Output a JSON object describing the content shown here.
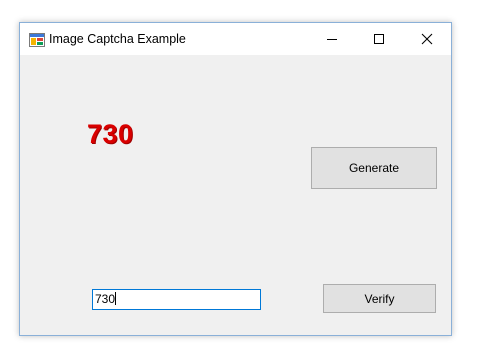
{
  "window": {
    "title": "Image Captcha Example",
    "icon": "form-app-icon",
    "controls": [
      "minimize-icon",
      "maximize-icon",
      "close-icon"
    ]
  },
  "form": {
    "captcha_text": "730",
    "captcha_color": "#d90000",
    "generate_label": "Generate",
    "verify_label": "Verify",
    "input_value": "730"
  }
}
